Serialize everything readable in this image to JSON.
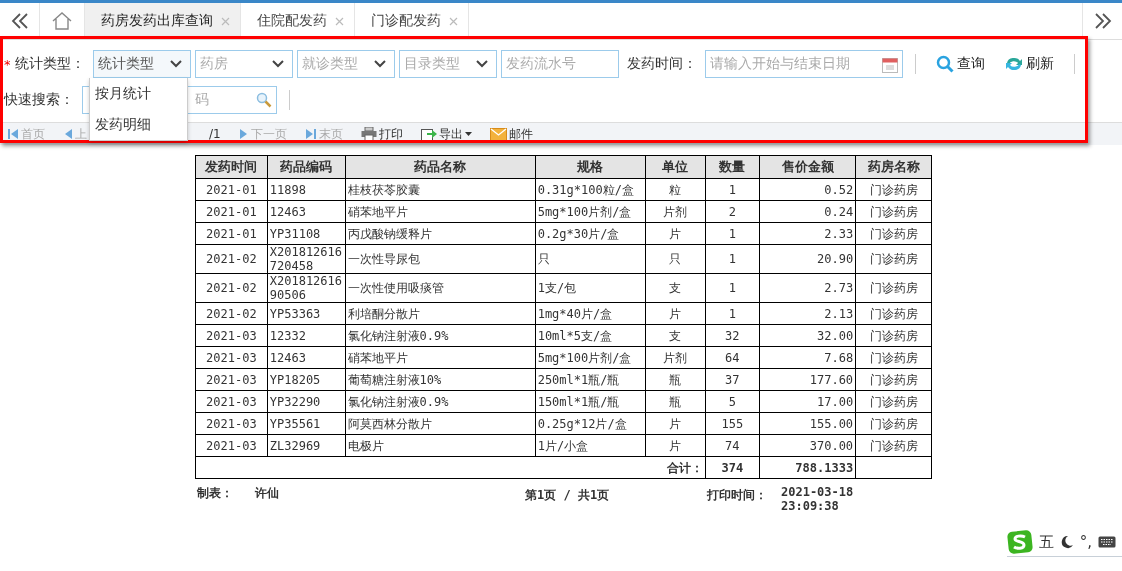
{
  "tabs": [
    {
      "label": "药房发药出库查询",
      "selected": true
    },
    {
      "label": "住院配发药",
      "selected": false
    },
    {
      "label": "门诊配发药",
      "selected": false
    }
  ],
  "filters": {
    "required_mark": "*",
    "type_label": "统计类型：",
    "selects": [
      {
        "placeholder": "统计类型",
        "focused": true
      },
      {
        "placeholder": "药房",
        "focused": false
      },
      {
        "placeholder": "就诊类型",
        "focused": false
      },
      {
        "placeholder": "目录类型",
        "focused": false
      }
    ],
    "serial_field": {
      "placeholder": "发药流水号"
    },
    "date_label": "发药时间：",
    "date_field": {
      "placeholder": "请输入开始与结束日期"
    },
    "buttons": [
      {
        "kind": "search",
        "label": "查询"
      },
      {
        "kind": "refresh",
        "label": "刷新"
      }
    ],
    "quick_label": "快速搜索：",
    "quick_field": {
      "placeholder": "码"
    }
  },
  "dropdown": {
    "options": [
      {
        "label": "按月统计",
        "selected": false
      },
      {
        "label": "发药明细",
        "selected": false
      }
    ]
  },
  "toolbar": [
    {
      "kind": "first",
      "label": "首页",
      "disabled": true
    },
    {
      "kind": "prev",
      "label": "上",
      "disabled": true
    },
    {
      "kind": "pages",
      "label": "/1"
    },
    {
      "kind": "next",
      "label": "下一页",
      "disabled": true
    },
    {
      "kind": "last",
      "label": "末页",
      "disabled": true
    },
    {
      "kind": "print",
      "label": "打印",
      "disabled": false
    },
    {
      "kind": "export",
      "label": "导出",
      "disabled": false
    },
    {
      "kind": "mail",
      "label": "邮件",
      "disabled": false
    }
  ],
  "table": {
    "columns": [
      "发药时间",
      "药品编码",
      "药品名称",
      "规格",
      "单位",
      "数量",
      "售价金额",
      "药房名称"
    ],
    "rows": [
      [
        "2021-01",
        "11898",
        "桂枝茯苓胶囊",
        "0.31g*100粒/盒",
        "粒",
        "1",
        "0.52",
        "门诊药房"
      ],
      [
        "2021-01",
        "12463",
        "硝苯地平片",
        "5mg*100片剂/盒",
        "片剂",
        "2",
        "0.24",
        "门诊药房"
      ],
      [
        "2021-01",
        "YP31108",
        "丙戊酸钠缓释片",
        "0.2g*30片/盒",
        "片",
        "1",
        "2.33",
        "门诊药房"
      ],
      [
        "2021-02",
        "X201812616720458",
        "一次性导尿包",
        "只",
        "只",
        "1",
        "20.90",
        "门诊药房"
      ],
      [
        "2021-02",
        "X20181261690506",
        "一次性使用吸痰管",
        "1支/包",
        "支",
        "1",
        "2.73",
        "门诊药房"
      ],
      [
        "2021-02",
        "YP53363",
        "利培酮分散片",
        "1mg*40片/盒",
        "片",
        "1",
        "2.13",
        "门诊药房"
      ],
      [
        "2021-03",
        "12332",
        "氯化钠注射液0.9%",
        "10ml*5支/盒",
        "支",
        "32",
        "32.00",
        "门诊药房"
      ],
      [
        "2021-03",
        "12463",
        "硝苯地平片",
        "5mg*100片剂/盒",
        "片剂",
        "64",
        "7.68",
        "门诊药房"
      ],
      [
        "2021-03",
        "YP18205",
        "葡萄糖注射液10%",
        "250ml*1瓶/瓶",
        "瓶",
        "37",
        "177.60",
        "门诊药房"
      ],
      [
        "2021-03",
        "YP32290",
        "氯化钠注射液0.9%",
        "150ml*1瓶/瓶",
        "瓶",
        "5",
        "17.00",
        "门诊药房"
      ],
      [
        "2021-03",
        "YP35561",
        "阿莫西林分散片",
        "0.25g*12片/盒",
        "片",
        "155",
        "155.00",
        "门诊药房"
      ],
      [
        "2021-03",
        "ZL32969",
        "电极片",
        "1片/小盒",
        "片",
        "74",
        "370.00",
        "门诊药房"
      ]
    ],
    "total": {
      "label": "合计：",
      "quantity": "374",
      "amount": "788.1333"
    }
  },
  "footer": {
    "maker_label": "制表：",
    "maker": "许仙",
    "page": "第1页 / 共1页",
    "print_label": "打印时间：",
    "print_time": "2021-03-18 23:09:38"
  },
  "ime": {
    "mode": "五",
    "punct": "°,"
  }
}
